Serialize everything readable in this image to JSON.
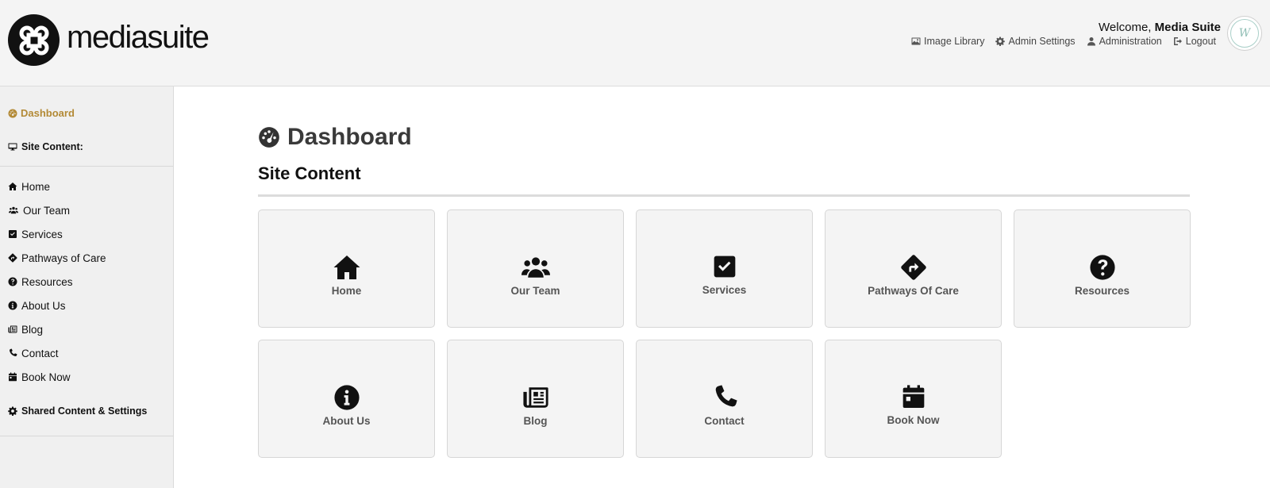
{
  "brand": {
    "name": "mediasuite"
  },
  "header": {
    "welcome_prefix": "Welcome,",
    "welcome_user": "Media Suite",
    "nav": [
      {
        "label": "Image Library",
        "icon": "image-icon"
      },
      {
        "label": "Admin Settings",
        "icon": "cogs-icon"
      },
      {
        "label": "Administration",
        "icon": "user-icon"
      },
      {
        "label": "Logout",
        "icon": "logout-icon"
      }
    ],
    "avatar_text": "W"
  },
  "sidebar": {
    "dashboard_label": "Dashboard",
    "site_content_label": "Site Content:",
    "items": [
      {
        "label": "Home",
        "icon": "home-icon"
      },
      {
        "label": "Our Team",
        "icon": "users-icon"
      },
      {
        "label": "Services",
        "icon": "check-square-icon"
      },
      {
        "label": "Pathways of Care",
        "icon": "directions-icon"
      },
      {
        "label": "Resources",
        "icon": "question-circle-icon"
      },
      {
        "label": "About Us",
        "icon": "info-circle-icon"
      },
      {
        "label": "Blog",
        "icon": "newspaper-icon"
      },
      {
        "label": "Contact",
        "icon": "phone-icon"
      },
      {
        "label": "Book Now",
        "icon": "calendar-icon"
      }
    ],
    "shared_label": "Shared Content & Settings"
  },
  "main": {
    "title": "Dashboard",
    "subtitle": "Site Content",
    "cards": [
      {
        "label": "Home",
        "icon": "home-icon"
      },
      {
        "label": "Our Team",
        "icon": "users-icon"
      },
      {
        "label": "Services",
        "icon": "check-square-icon"
      },
      {
        "label": "Pathways Of Care",
        "icon": "directions-icon"
      },
      {
        "label": "Resources",
        "icon": "question-circle-icon"
      },
      {
        "label": "About Us",
        "icon": "info-circle-icon"
      },
      {
        "label": "Blog",
        "icon": "newspaper-icon"
      },
      {
        "label": "Contact",
        "icon": "phone-icon"
      },
      {
        "label": "Book Now",
        "icon": "calendar-icon"
      }
    ]
  },
  "colors": {
    "accent": "#b38a36",
    "header_bg": "#f4f4f4",
    "sidebar_bg": "#f0f0f0",
    "card_bg": "#f4f4f4"
  }
}
